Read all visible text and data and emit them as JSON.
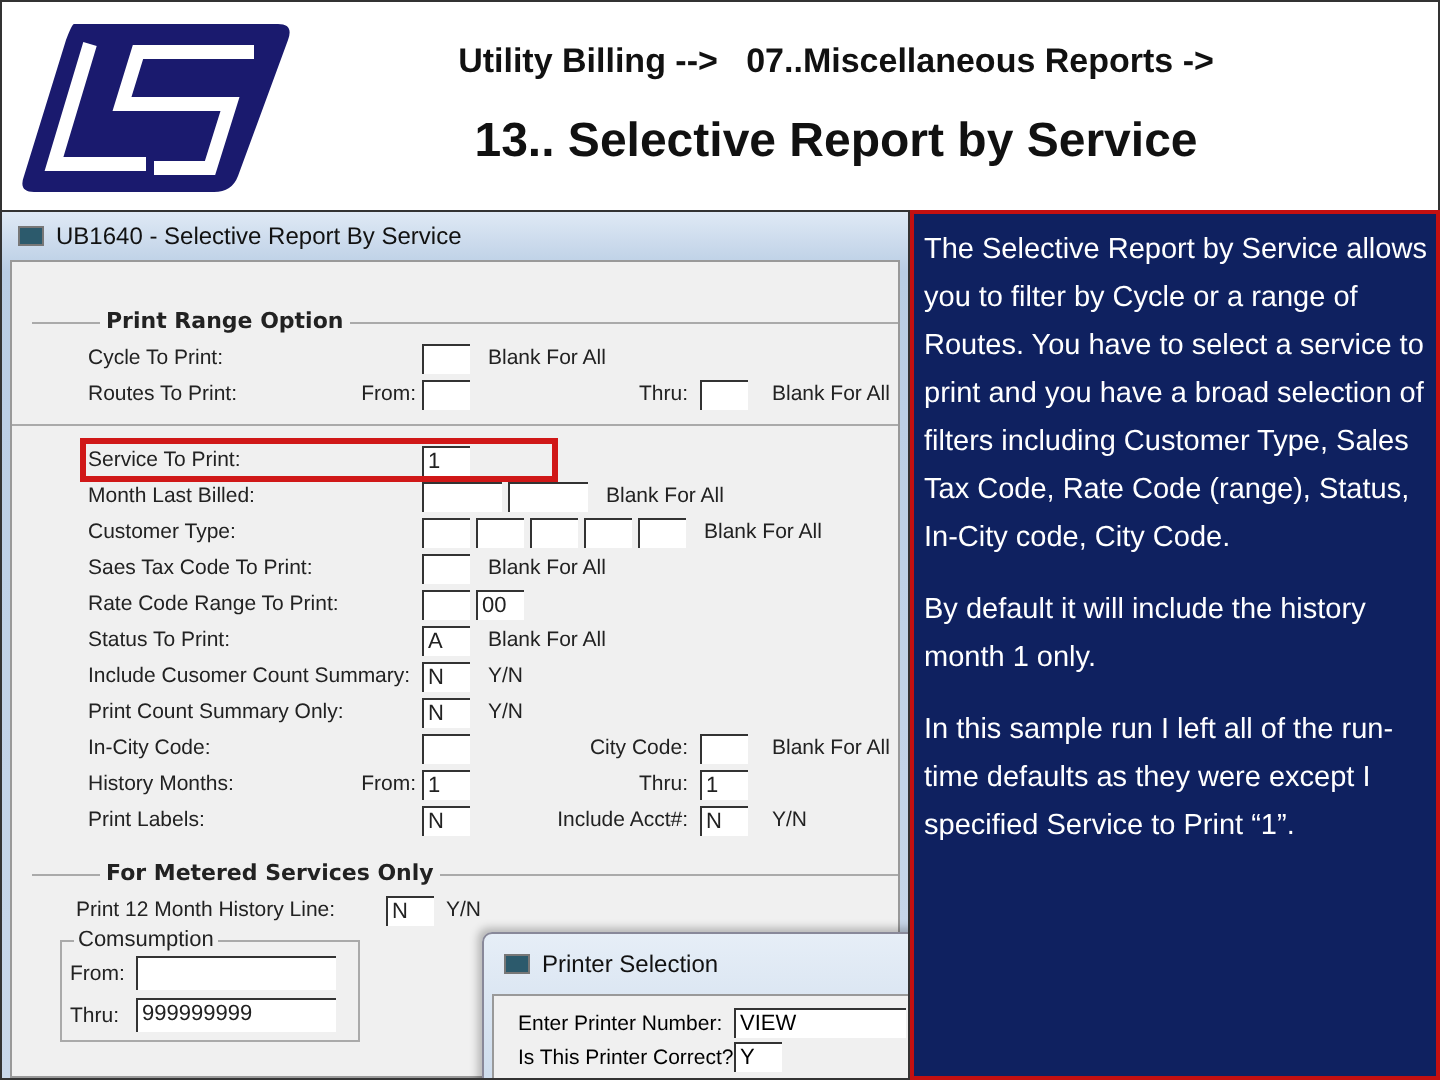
{
  "header": {
    "breadcrumb": "Utility Billing -->   07..Miscellaneous Reports ->",
    "title": "13.. Selective Report by Service"
  },
  "window": {
    "title": "UB1640 - Selective Report By Service",
    "range_group": {
      "legend": "Print Range Option",
      "top_rows": [
        {
          "label": "Cycle To Print:",
          "highlighted": false,
          "main": [
            {
              "kind": "field"
            },
            {
              "kind": "note",
              "text": "Blank For All"
            }
          ]
        },
        {
          "label": "Routes To Print:",
          "prefix": "From:",
          "highlighted": false,
          "main": [
            {
              "kind": "field"
            }
          ],
          "aside": [
            {
              "kind": "caption",
              "text": "Thru:"
            },
            {
              "kind": "field"
            },
            {
              "kind": "note",
              "text": "Blank For All"
            }
          ]
        }
      ],
      "rows": [
        {
          "label": "Service To Print:",
          "highlighted": true,
          "main": [
            {
              "kind": "field",
              "value": "1"
            }
          ]
        },
        {
          "label": "Month Last Billed:",
          "highlighted": false,
          "main": [
            {
              "kind": "wide-field"
            },
            {
              "kind": "wide-field"
            },
            {
              "kind": "note",
              "text": "Blank For All"
            }
          ]
        },
        {
          "label": "Customer Type:",
          "highlighted": false,
          "main": [
            {
              "kind": "field"
            },
            {
              "kind": "field"
            },
            {
              "kind": "field"
            },
            {
              "kind": "field"
            },
            {
              "kind": "field"
            },
            {
              "kind": "note",
              "text": "Blank For All"
            }
          ]
        },
        {
          "label": "Saes Tax Code To Print:",
          "highlighted": false,
          "main": [
            {
              "kind": "field"
            },
            {
              "kind": "note",
              "text": "Blank For All"
            }
          ]
        },
        {
          "label": "Rate Code Range To Print:",
          "highlighted": false,
          "main": [
            {
              "kind": "field"
            },
            {
              "kind": "field",
              "value": "00"
            }
          ]
        },
        {
          "label": "Status To Print:",
          "highlighted": false,
          "main": [
            {
              "kind": "field",
              "value": "A"
            },
            {
              "kind": "note",
              "text": "Blank For All"
            }
          ]
        },
        {
          "label": "Include Cusomer Count Summary:",
          "highlighted": false,
          "main": [
            {
              "kind": "field",
              "value": "N"
            },
            {
              "kind": "note",
              "text": "Y/N"
            }
          ]
        },
        {
          "label": "Print Count Summary Only:",
          "highlighted": false,
          "main": [
            {
              "kind": "field",
              "value": "N"
            },
            {
              "kind": "note",
              "text": "Y/N"
            }
          ]
        },
        {
          "label": "In-City Code:",
          "highlighted": false,
          "main": [
            {
              "kind": "field"
            }
          ],
          "aside": [
            {
              "kind": "caption",
              "text": "City Code:"
            },
            {
              "kind": "field"
            },
            {
              "kind": "note",
              "text": "Blank For All"
            }
          ]
        },
        {
          "label": "History Months:",
          "prefix": "From:",
          "highlighted": false,
          "main": [
            {
              "kind": "field",
              "value": "1"
            }
          ],
          "aside": [
            {
              "kind": "caption",
              "text": "Thru:"
            },
            {
              "kind": "field",
              "value": "1"
            }
          ]
        },
        {
          "label": "Print Labels:",
          "highlighted": false,
          "main": [
            {
              "kind": "field",
              "value": "N"
            }
          ],
          "aside": [
            {
              "kind": "caption",
              "text": "Include Acct#:"
            },
            {
              "kind": "field",
              "value": "N"
            },
            {
              "kind": "note",
              "text": "Y/N"
            }
          ]
        }
      ]
    },
    "metered_group": {
      "legend": "For Metered Services Only",
      "history_label": "Print 12 Month History Line:",
      "history_value": "N",
      "history_note": "Y/N",
      "consumption": {
        "legend": "Comsumption",
        "from_label": "From:",
        "thru_label": "Thru:",
        "thru_value": "999999999"
      }
    }
  },
  "printer_dialog": {
    "title": "Printer Selection",
    "rows": [
      {
        "label": "Enter Printer Number:",
        "value": "VIEW"
      },
      {
        "label": "Is This Printer Correct?",
        "value": "Y"
      }
    ]
  },
  "explanation": [
    "The Selective Report by Service allows you to filter by Cycle or a range of Routes. You have to select a service to print and you have a broad selection of filters including Customer Type, Sales Tax Code, Rate Code (range), Status, In-City code, City Code.",
    "By default it will include the history month 1 only.",
    "In this sample run I left all of the run-time defaults as they were except I specified Service  to Print “1”."
  ]
}
